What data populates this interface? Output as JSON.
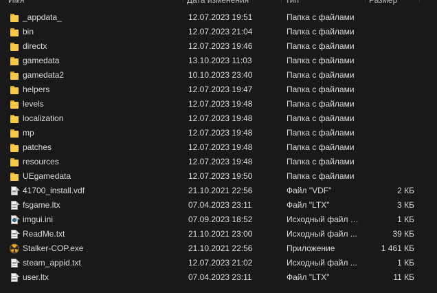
{
  "header": {
    "name": "Имя",
    "date": "Дата изменения",
    "type": "Тип",
    "size": "Размер"
  },
  "files": [
    {
      "name": "_appdata_",
      "date": "12.07.2023 19:51",
      "type": "Папка с файлами",
      "size": "",
      "icon": "folder-icon"
    },
    {
      "name": "bin",
      "date": "12.07.2023 21:04",
      "type": "Папка с файлами",
      "size": "",
      "icon": "folder-icon"
    },
    {
      "name": "directx",
      "date": "12.07.2023 19:46",
      "type": "Папка с файлами",
      "size": "",
      "icon": "folder-icon"
    },
    {
      "name": "gamedata",
      "date": "13.10.2023 11:03",
      "type": "Папка с файлами",
      "size": "",
      "icon": "folder-icon"
    },
    {
      "name": "gamedata2",
      "date": "10.10.2023 23:40",
      "type": "Папка с файлами",
      "size": "",
      "icon": "folder-icon"
    },
    {
      "name": "helpers",
      "date": "12.07.2023 19:47",
      "type": "Папка с файлами",
      "size": "",
      "icon": "folder-icon"
    },
    {
      "name": "levels",
      "date": "12.07.2023 19:48",
      "type": "Папка с файлами",
      "size": "",
      "icon": "folder-icon"
    },
    {
      "name": "localization",
      "date": "12.07.2023 19:48",
      "type": "Папка с файлами",
      "size": "",
      "icon": "folder-icon"
    },
    {
      "name": "mp",
      "date": "12.07.2023 19:48",
      "type": "Папка с файлами",
      "size": "",
      "icon": "folder-icon"
    },
    {
      "name": "patches",
      "date": "12.07.2023 19:48",
      "type": "Папка с файлами",
      "size": "",
      "icon": "folder-icon"
    },
    {
      "name": "resources",
      "date": "12.07.2023 19:48",
      "type": "Папка с файлами",
      "size": "",
      "icon": "folder-icon"
    },
    {
      "name": "UEgamedata",
      "date": "12.07.2023 19:50",
      "type": "Папка с файлами",
      "size": "",
      "icon": "folder-icon"
    },
    {
      "name": "41700_install.vdf",
      "date": "21.10.2021 22:56",
      "type": "Файл \"VDF\"",
      "size": "2 КБ",
      "icon": "file-icon"
    },
    {
      "name": "fsgame.ltx",
      "date": "07.04.2023 23:11",
      "type": "Файл \"LTX\"",
      "size": "3 КБ",
      "icon": "file-icon"
    },
    {
      "name": "imgui.ini",
      "date": "07.09.2023 18:52",
      "type": "Исходный файл I...",
      "size": "1 КБ",
      "icon": "ini-file-icon"
    },
    {
      "name": "ReadMe.txt",
      "date": "21.10.2021 23:00",
      "type": "Исходный файл ...",
      "size": "39 КБ",
      "icon": "file-icon"
    },
    {
      "name": "Stalker-COP.exe",
      "date": "21.10.2021 22:56",
      "type": "Приложение",
      "size": "1 461 КБ",
      "icon": "radiation-exe-icon"
    },
    {
      "name": "steam_appid.txt",
      "date": "12.07.2023 21:02",
      "type": "Исходный файл ...",
      "size": "1 КБ",
      "icon": "file-icon"
    },
    {
      "name": "user.ltx",
      "date": "07.04.2023 23:11",
      "type": "Файл \"LTX\"",
      "size": "11 КБ",
      "icon": "file-icon"
    }
  ]
}
